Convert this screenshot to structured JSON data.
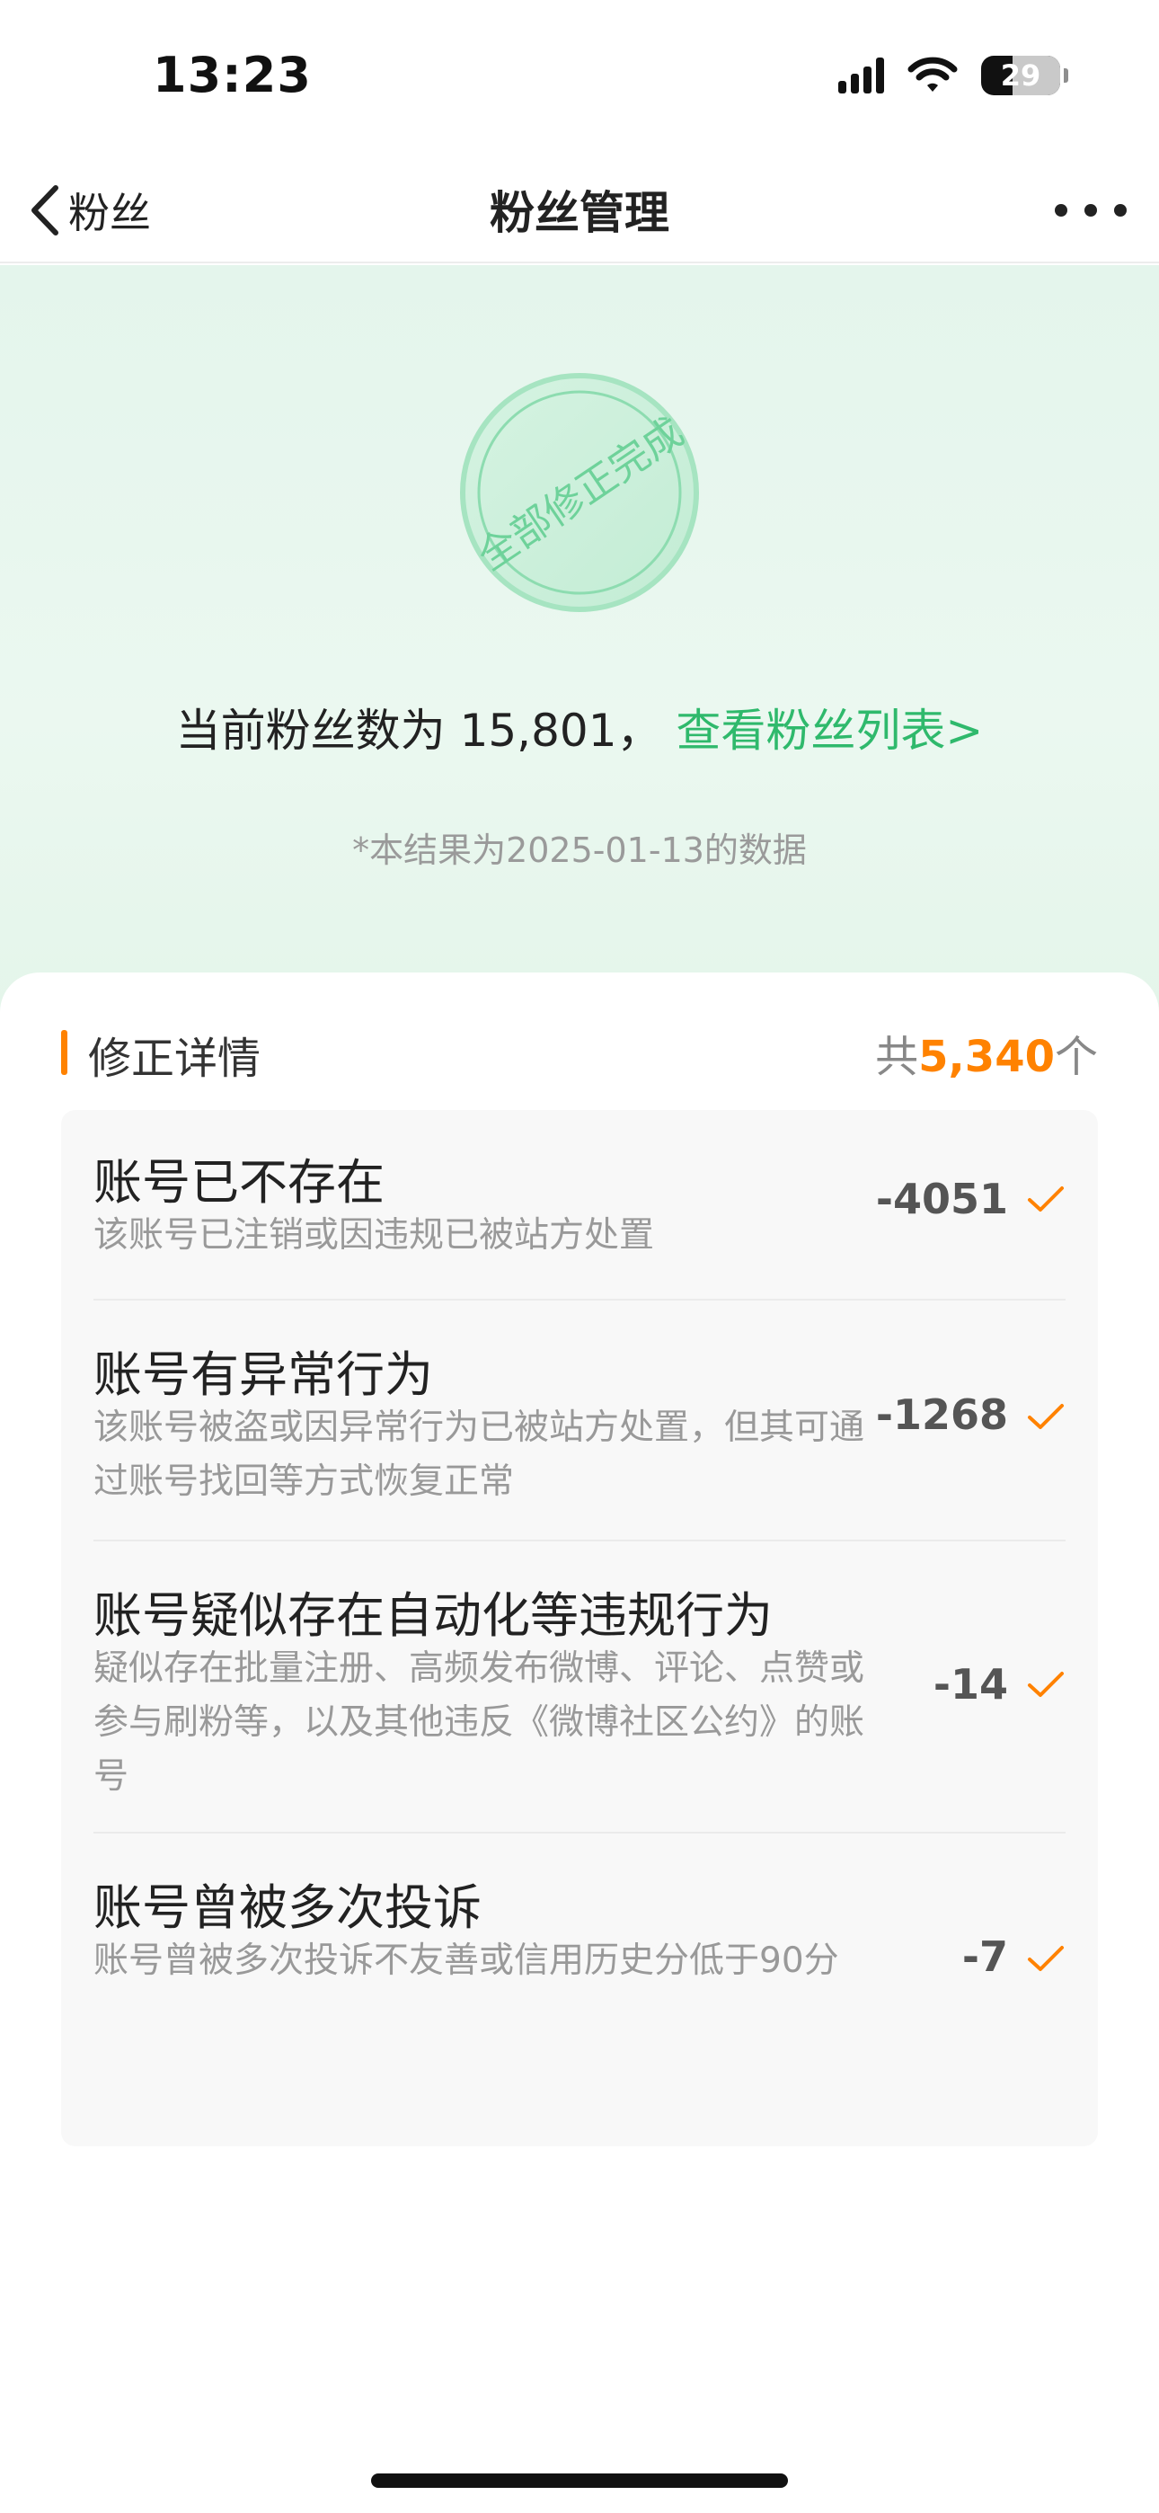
{
  "status_bar": {
    "time": "13:23",
    "battery": "29"
  },
  "nav": {
    "back_label": "粉丝",
    "title": "粉丝管理"
  },
  "hero": {
    "stamp_text": "全部修正完成",
    "count_prefix": "当前粉丝数为",
    "count_value": "15,801",
    "count_sep": "，",
    "list_link": "查看粉丝列表>",
    "note": "*本结果为2025-01-13的数据"
  },
  "details": {
    "title": "修正详情",
    "total_prefix": "共",
    "total_value": "5,340",
    "total_suffix": "个",
    "items": [
      {
        "title": "账号已不存在",
        "desc": "该账号已注销或因违规已被站方处置",
        "value": "-4051"
      },
      {
        "title": "账号有异常行为",
        "desc": "该账号被盗或因异常行为已被站方处置，但其可通过账号找回等方式恢复正常",
        "value": "-1268"
      },
      {
        "title": "账号疑似存在自动化等违规行为",
        "desc": "疑似存在批量注册、高频发布微博、评论、点赞或参与刷粉等，以及其他违反《微博社区公约》的账号",
        "value": "-14"
      },
      {
        "title": "账号曾被多次投诉",
        "desc": "账号曾被多次投诉不友善或信用历史分低于90分",
        "value": "-7"
      }
    ]
  },
  "colors": {
    "accent": "#ff8200",
    "link": "#2fb96c",
    "stamp": "#7fd9a6",
    "hero_bg": "#e4f5ec"
  },
  "icons": [
    "back-chevron-icon",
    "more-dots-icon",
    "signal-icon",
    "wifi-icon",
    "battery-icon",
    "check-icon",
    "stamp-seal"
  ]
}
